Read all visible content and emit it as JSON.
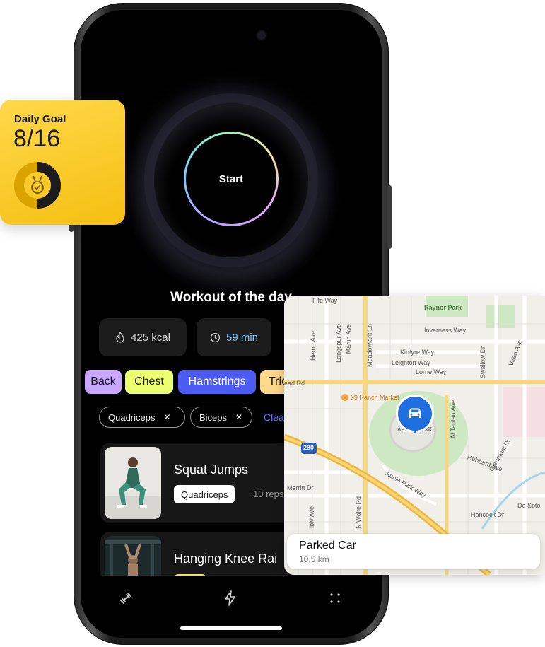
{
  "start": {
    "label": "Start"
  },
  "workout": {
    "title": "Workout of the day",
    "calories": "425 kcal",
    "duration": "59 min"
  },
  "muscle_chips": [
    {
      "label": "Back",
      "color": "#c9a6ff"
    },
    {
      "label": "Chest",
      "color": "#ecff6e"
    },
    {
      "label": "Hamstrings",
      "color": "#4c5cf2"
    },
    {
      "label": "Tric",
      "color": "#ffd98a"
    }
  ],
  "filters": {
    "tags": [
      "Quadriceps",
      "Biceps"
    ],
    "clear_label": "Clea"
  },
  "exercises": [
    {
      "title": "Squat Jumps",
      "muscle": "Quadriceps",
      "reps": "10 reps"
    },
    {
      "title": "Hanging Knee Rai"
    }
  ],
  "tabbar": {
    "icons": [
      "dumbbell-icon",
      "lightning-icon",
      "grid-icon"
    ]
  },
  "daily_goal": {
    "label": "Daily Goal",
    "value": "8/16",
    "progress": 0.5,
    "accent": "#f5bf12"
  },
  "map": {
    "labels": {
      "fife_way": "Fife Way",
      "raynor_park": "Raynor Park",
      "inverness_way": "Inverness Way",
      "kintyre_way": "Kintyre Way",
      "leighton_way": "Leighton Way",
      "lorne_way": "Lorne Way",
      "ranch_market": "99 Ranch Market",
      "apple_park": "APPLE PARK",
      "apple_park_way": "Apple Park Way",
      "hubbard_ave": "Hubbard Ave",
      "hancock_dr": "Hancock Dr",
      "de_soto": "De Soto",
      "merritt_dr": "Merritt Dr",
      "ead_rd": "ead Rd",
      "i280": "280",
      "heron_ave": "Heron Ave",
      "longspur_ave": "Longspur Ave",
      "martin_ave": "Martin Ave",
      "meadowlark_ln": "Meadowlark Ln",
      "swallow_dr": "Swallow Dr",
      "vireo_ave": "Vireo Ave",
      "n_tantau_ave": "N Tantau Ave",
      "n_wolfe_rd": "N Wolfe Rd",
      "glenmont_dr": "Glenmont Dr",
      "ibly_ave": "ibly Ave"
    },
    "parked": {
      "title": "Parked Car",
      "distance": "10.5 km"
    }
  }
}
